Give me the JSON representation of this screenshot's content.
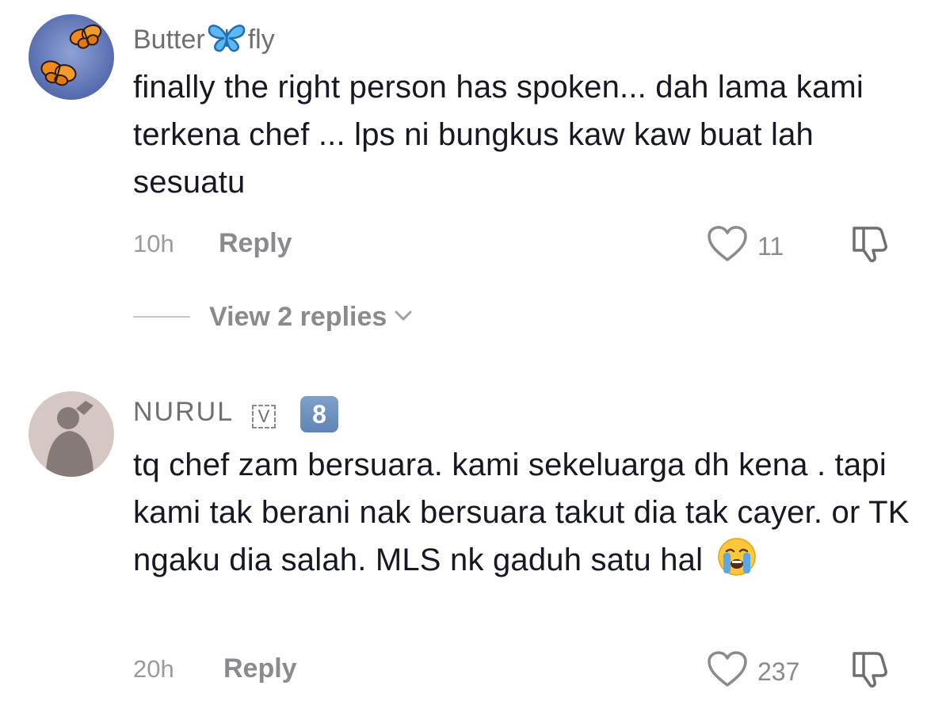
{
  "comments": [
    {
      "username_left": "Butter",
      "username_emoji": "butterfly-emoji",
      "username_right": "fly",
      "text": "finally the right person has spoken... dah lama kami terkena chef ... lps ni bungkus kaw kaw buat lah sesuatu",
      "time": "10h",
      "reply_label": "Reply",
      "like_count": "11",
      "view_replies_label": "View 2 replies"
    },
    {
      "username": "NURUL",
      "badge_v": "V",
      "badge_num": "8",
      "text": "tq chef zam bersuara. kami sekeluarga dh kena . tapi kami tak berani nak bersuara takut dia tak cayer. or TK ngaku dia salah. MLS nk gaduh satu hal",
      "text_emoji": "loudly-crying-face-emoji",
      "time": "20h",
      "reply_label": "Reply",
      "like_count": "237"
    }
  ],
  "icons": {
    "like": "heart-outline-icon",
    "dislike": "thumbs-down-outline-icon",
    "expand": "chevron-down-icon"
  },
  "colors": {
    "text": "#161823",
    "muted": "#8a8a90",
    "butterfly_blue": "#2f8fd8"
  }
}
